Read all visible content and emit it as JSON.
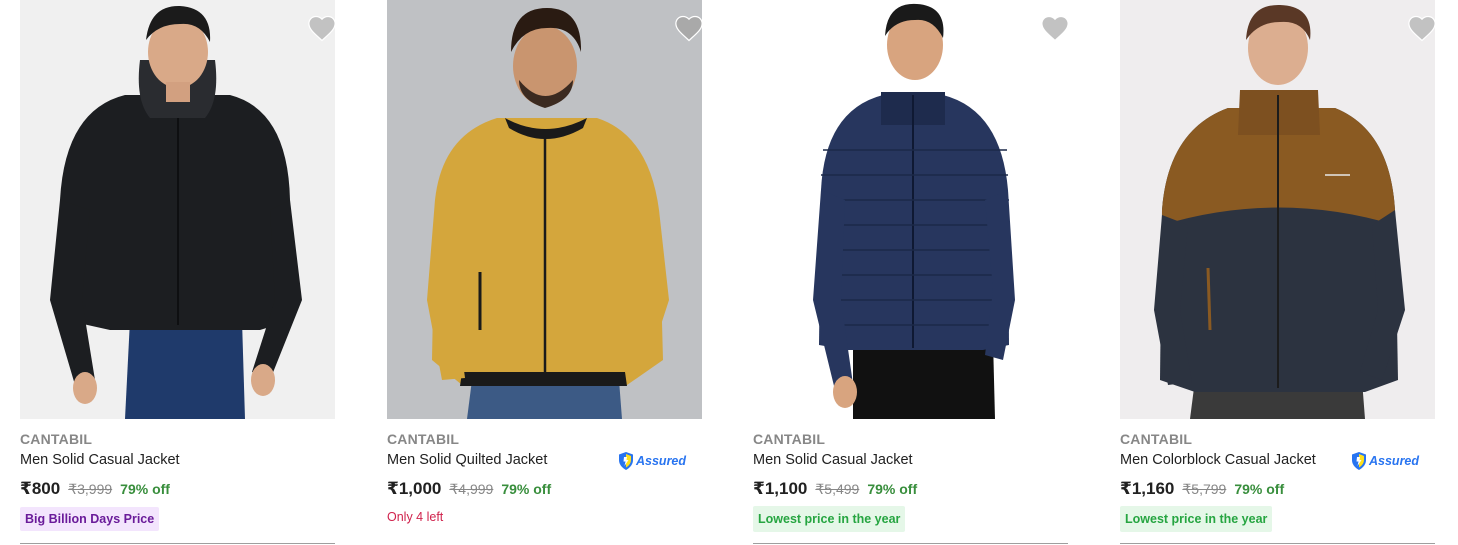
{
  "products": [
    {
      "brand": "CANTABIL",
      "title": "Men Solid Casual Jacket",
      "price": "₹800",
      "mrp": "₹3,999",
      "discount": "79% off",
      "tag": "Big Billion Days Price",
      "tag_style": "purple",
      "assured": false,
      "image": {
        "subject": "man in black hooded jacket",
        "jacket_color": "#1c1e21",
        "background": "#f0f0f0"
      }
    },
    {
      "brand": "CANTABIL",
      "title": "Men Solid Quilted Jacket",
      "price": "₹1,000",
      "mrp": "₹4,999",
      "discount": "79% off",
      "tag": "Only 4 left",
      "tag_style": "red",
      "assured": true,
      "assured_label": "Assured",
      "image": {
        "subject": "man in mustard bomber jacket",
        "jacket_color": "#d4a63c",
        "background": "#bfc1c4"
      }
    },
    {
      "brand": "CANTABIL",
      "title": "Men Solid Casual Jacket",
      "price": "₹1,100",
      "mrp": "₹5,499",
      "discount": "79% off",
      "tag": "Lowest price in the year",
      "tag_style": "green",
      "assured": false,
      "image": {
        "subject": "man in navy quilted puffer jacket",
        "jacket_color": "#27365e",
        "background": "#ffffff"
      }
    },
    {
      "brand": "CANTABIL",
      "title": "Men Colorblock Casual Jacket",
      "price": "₹1,160",
      "mrp": "₹5,799",
      "discount": "79% off",
      "tag": "Lowest price in the year",
      "tag_style": "green",
      "assured": true,
      "assured_label": "Assured",
      "image": {
        "subject": "man in brown and navy colorblock jacket",
        "jacket_color": "#2c3340",
        "background": "#efedee"
      }
    }
  ],
  "icons": {
    "wishlist": "heart-icon",
    "assured": "shield-icon"
  },
  "colors": {
    "discount": "#388e3c",
    "assured": "#2874f0",
    "tag_purple": "#6a1b9a",
    "tag_green": "#26a541",
    "tag_red": "#d0234d",
    "wishlist": "#c2c2c2"
  }
}
